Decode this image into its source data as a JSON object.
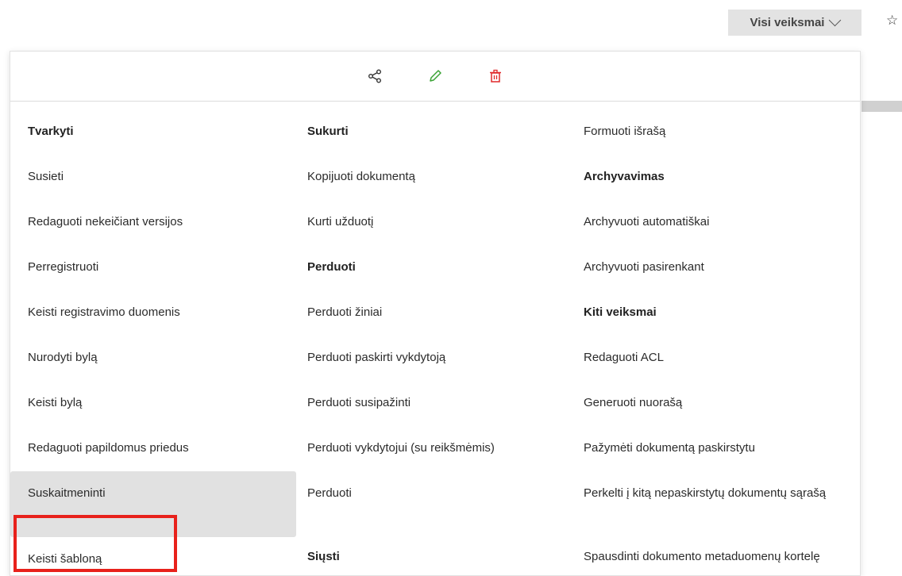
{
  "topbar": {
    "actions_label": "Visi veiksmai",
    "chevron_icon": "chevron-down-icon",
    "star_icon": "star-icon"
  },
  "iconbar": {
    "icons": [
      "share-icon",
      "pencil-icon",
      "trash-icon"
    ],
    "colors": {
      "share": "#333333",
      "pencil": "#3aa335",
      "trash": "#e0282a"
    }
  },
  "menu": {
    "col1": [
      {
        "label": "Tvarkyti",
        "heading": true
      },
      {
        "label": "Susieti"
      },
      {
        "label": "Redaguoti nekeičiant versijos"
      },
      {
        "label": "Perregistruoti"
      },
      {
        "label": "Keisti registravimo duomenis"
      },
      {
        "label": "Nurodyti bylą"
      },
      {
        "label": "Keisti bylą"
      },
      {
        "label": "Redaguoti papildomus priedus"
      },
      {
        "label": "Suskaitmeninti",
        "highlighted": true
      },
      {
        "label": "Keisti šabloną"
      }
    ],
    "col2": [
      {
        "label": "Sukurti",
        "heading": true
      },
      {
        "label": "Kopijuoti dokumentą"
      },
      {
        "label": "Kurti užduotį"
      },
      {
        "label": "Perduoti",
        "heading": true
      },
      {
        "label": "Perduoti žiniai"
      },
      {
        "label": "Perduoti paskirti vykdytoją"
      },
      {
        "label": "Perduoti susipažinti"
      },
      {
        "label": "Perduoti vykdytojui (su reikšmėmis)"
      },
      {
        "label": "Perduoti"
      },
      {
        "label": "Siųsti",
        "heading": true
      }
    ],
    "col3": [
      {
        "label": "Formuoti išrašą"
      },
      {
        "label": "Archyvavimas",
        "heading": true
      },
      {
        "label": "Archyvuoti automatiškai"
      },
      {
        "label": "Archyvuoti pasirenkant"
      },
      {
        "label": "Kiti veiksmai",
        "heading": true
      },
      {
        "label": "Redaguoti ACL"
      },
      {
        "label": "Generuoti nuorašą"
      },
      {
        "label": "Pažymėti dokumentą paskirstytu"
      },
      {
        "label": "Perkelti į kitą nepaskirstytų dokumentų sąrašą"
      },
      {
        "label": "Spausdinti dokumento metaduomenų kortelę"
      }
    ]
  },
  "highlight_color": "#e8211b"
}
